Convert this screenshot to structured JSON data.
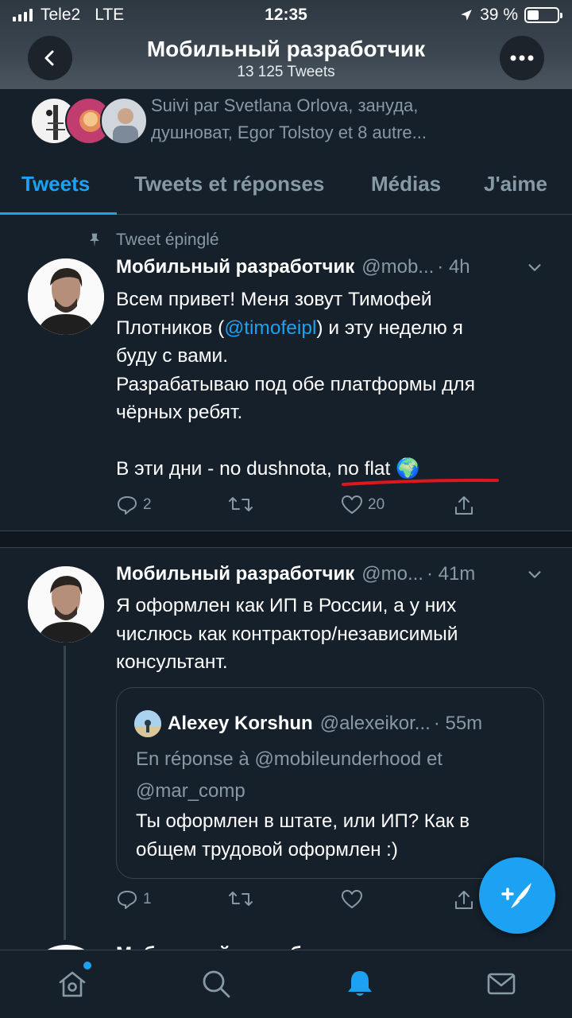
{
  "status": {
    "carrier": "Tele2",
    "network": "LTE",
    "time": "12:35",
    "battery": "39 %",
    "battery_level": 0.39
  },
  "nav": {
    "title": "Мобильный разработчик",
    "subtitle": "13 125 Tweets"
  },
  "followed_by": {
    "text": "Suivi par Svetlana Orlova, зануда, душноват, Egor Tolstoy et 8 autre..."
  },
  "tabs": [
    {
      "label": "Tweets",
      "active": true
    },
    {
      "label": "Tweets et réponses",
      "active": false
    },
    {
      "label": "Médias",
      "active": false
    },
    {
      "label": "J'aime",
      "active": false
    }
  ],
  "pinned_tweet": {
    "pinned_label": "Tweet épinglé",
    "name": "Мобильный разработчик",
    "handle": "@mob...",
    "time": "· 4h",
    "text_before": "Всем привет! Меня зовут Тимофей\nПлотников (",
    "mention": "@timofeipl",
    "text_after": ") и эту неделю я\nбуду с вами.\nРазрабатываю под обе платформы для\nчёрных ребят.\n\nВ эти дни - no dushnota, no flat ",
    "emoji": "🌍",
    "replies": "2",
    "retweets": "",
    "likes": "20"
  },
  "tweet2": {
    "name": "Мобильный разработчик",
    "handle": "@mo...",
    "time": "· 41m",
    "text": "Я оформлен как ИП в России, а у них\nчислюсь как контрактор/независимый\nконсультант.",
    "quote": {
      "name": "Alexey Korshun",
      "handle": "@alexeikor...",
      "time": "· 55m",
      "reply_to": "En réponse à @mobileunderhood et @mar_comp",
      "text": "Ты оформлен в штате, или ИП? Как в общем трудовой оформлен :)"
    },
    "replies": "1",
    "retweets": "",
    "likes": ""
  },
  "peek_name": "Мобильный разработчик",
  "colors": {
    "accent": "#1da1f2",
    "background": "#15202b",
    "secondary_text": "#8899a6",
    "annotation_underline": "#e0161e"
  },
  "icons": {
    "back": "chevron-left-icon",
    "more": "ellipsis-icon",
    "pin": "pin-icon",
    "reply": "reply-icon",
    "retweet": "retweet-icon",
    "like": "heart-icon",
    "share": "share-icon",
    "compose": "compose-tweet-icon",
    "home": "home-icon",
    "search": "search-icon",
    "notifications": "bell-icon",
    "messages": "mail-icon"
  }
}
